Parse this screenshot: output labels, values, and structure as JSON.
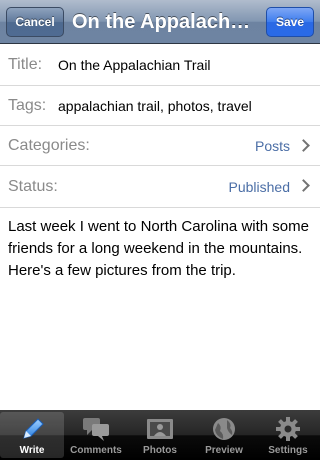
{
  "navbar": {
    "cancel_label": "Cancel",
    "title": "On the Appalach…",
    "save_label": "Save"
  },
  "fields": {
    "title_label": "Title:",
    "title_value": "On the Appalachian Trail",
    "tags_label": "Tags:",
    "tags_value": "appalachian trail, photos, travel",
    "categories_label": "Categories:",
    "categories_value": "Posts",
    "status_label": "Status:",
    "status_value": "Published"
  },
  "post_body": "Last week I went to North Carolina with some friends for a long weekend in the mountains. Here's a few pictures from the trip.",
  "tabs": [
    {
      "label": "Write",
      "icon": "pencil-icon",
      "active": true
    },
    {
      "label": "Comments",
      "icon": "speech-bubbles-icon",
      "active": false
    },
    {
      "label": "Photos",
      "icon": "photo-icon",
      "active": false
    },
    {
      "label": "Preview",
      "icon": "globe-icon",
      "active": false
    },
    {
      "label": "Settings",
      "icon": "gear-icon",
      "active": false
    }
  ],
  "colors": {
    "accent_link": "#4b6ea6",
    "save_button": "#2a6ae6",
    "navbar": "#6d83a1"
  }
}
